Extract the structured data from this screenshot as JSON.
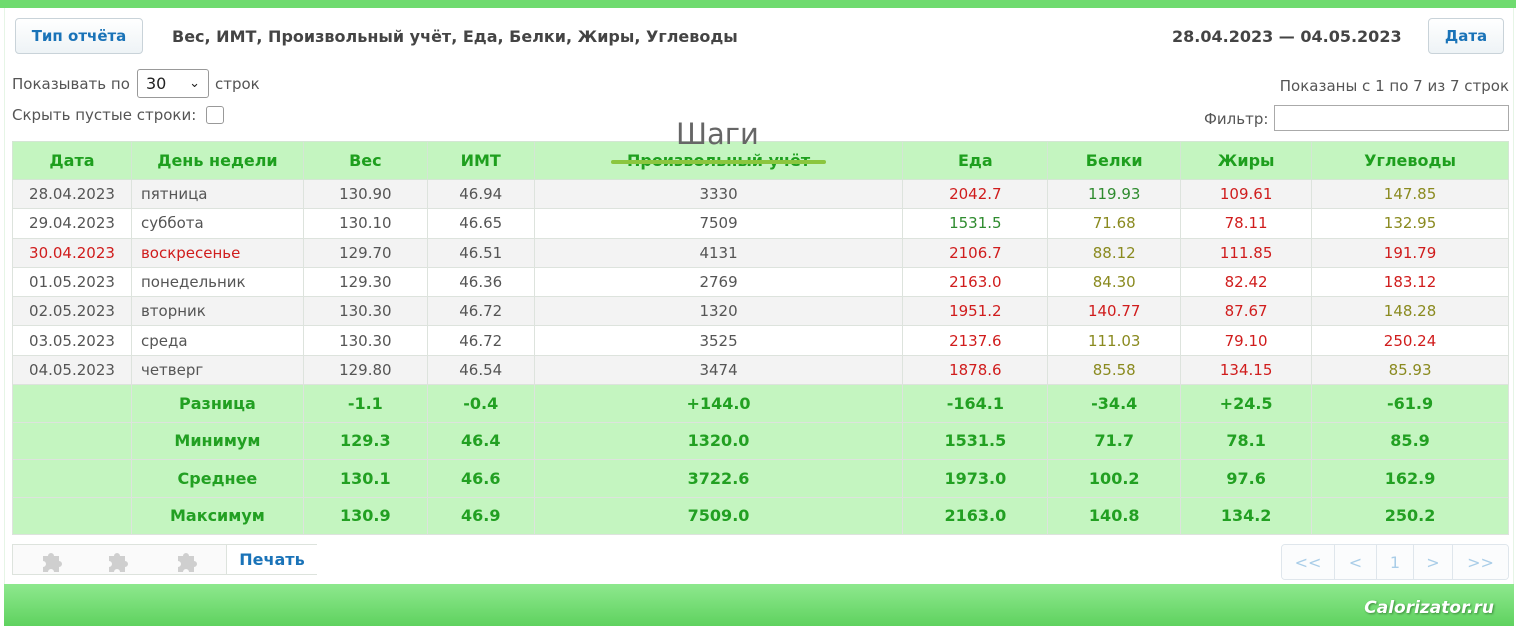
{
  "header": {
    "report_type_button": "Тип отчёта",
    "report_title": "Вес, ИМТ, Произвольный учёт, Еда, Белки, Жиры, Углеводы",
    "date_range": "28.04.2023 — 04.05.2023",
    "date_button": "Дата"
  },
  "controls": {
    "show_per_label": "Показывать по",
    "rows_per_page": "30",
    "rows_label": "строк",
    "hide_empty_label": "Скрыть пустые строки:",
    "showing_info": "Показаны с 1 по 7 из 7 строк",
    "filter_label": "Фильтр:",
    "filter_value": ""
  },
  "overlay_label": "Шаги",
  "table": {
    "columns": [
      "Дата",
      "День недели",
      "Вес",
      "ИМТ",
      "Произвольный учёт",
      "Еда",
      "Белки",
      "Жиры",
      "Углеводы"
    ],
    "rows": [
      {
        "date": "28.04.2023",
        "dow": "пятница",
        "weight": "130.90",
        "bmi": "46.94",
        "custom": "3330",
        "food": "2042.7",
        "protein": "119.93",
        "fat": "109.61",
        "carbs": "147.85",
        "weekend": false,
        "colors": {
          "food": "red",
          "protein": "green",
          "fat": "red",
          "carbs": "olive"
        }
      },
      {
        "date": "29.04.2023",
        "dow": "суббота",
        "weight": "130.10",
        "bmi": "46.65",
        "custom": "7509",
        "food": "1531.5",
        "protein": "71.68",
        "fat": "78.11",
        "carbs": "132.95",
        "weekend": false,
        "colors": {
          "food": "green",
          "protein": "olive",
          "fat": "red",
          "carbs": "olive"
        }
      },
      {
        "date": "30.04.2023",
        "dow": "воскресенье",
        "weight": "129.70",
        "bmi": "46.51",
        "custom": "4131",
        "food": "2106.7",
        "protein": "88.12",
        "fat": "111.85",
        "carbs": "191.79",
        "weekend": true,
        "colors": {
          "food": "red",
          "protein": "olive",
          "fat": "red",
          "carbs": "red"
        }
      },
      {
        "date": "01.05.2023",
        "dow": "понедельник",
        "weight": "129.30",
        "bmi": "46.36",
        "custom": "2769",
        "food": "2163.0",
        "protein": "84.30",
        "fat": "82.42",
        "carbs": "183.12",
        "weekend": false,
        "colors": {
          "food": "red",
          "protein": "olive",
          "fat": "red",
          "carbs": "red"
        }
      },
      {
        "date": "02.05.2023",
        "dow": "вторник",
        "weight": "130.30",
        "bmi": "46.72",
        "custom": "1320",
        "food": "1951.2",
        "protein": "140.77",
        "fat": "87.67",
        "carbs": "148.28",
        "weekend": false,
        "colors": {
          "food": "red",
          "protein": "red",
          "fat": "red",
          "carbs": "olive"
        }
      },
      {
        "date": "03.05.2023",
        "dow": "среда",
        "weight": "130.30",
        "bmi": "46.72",
        "custom": "3525",
        "food": "2137.6",
        "protein": "111.03",
        "fat": "79.10",
        "carbs": "250.24",
        "weekend": false,
        "colors": {
          "food": "red",
          "protein": "olive",
          "fat": "red",
          "carbs": "red"
        }
      },
      {
        "date": "04.05.2023",
        "dow": "четверг",
        "weight": "129.80",
        "bmi": "46.54",
        "custom": "3474",
        "food": "1878.6",
        "protein": "85.58",
        "fat": "134.15",
        "carbs": "85.93",
        "weekend": false,
        "colors": {
          "food": "red",
          "protein": "olive",
          "fat": "red",
          "carbs": "olive"
        }
      }
    ],
    "summary": [
      {
        "label": "Разница",
        "weight": "-1.1",
        "bmi": "-0.4",
        "custom": "+144.0",
        "food": "-164.1",
        "protein": "-34.4",
        "fat": "+24.5",
        "carbs": "-61.9"
      },
      {
        "label": "Минимум",
        "weight": "129.3",
        "bmi": "46.4",
        "custom": "1320.0",
        "food": "1531.5",
        "protein": "71.7",
        "fat": "78.1",
        "carbs": "85.9"
      },
      {
        "label": "Среднее",
        "weight": "130.1",
        "bmi": "46.6",
        "custom": "3722.6",
        "food": "1973.0",
        "protein": "100.2",
        "fat": "97.6",
        "carbs": "162.9"
      },
      {
        "label": "Максимум",
        "weight": "130.9",
        "bmi": "46.9",
        "custom": "7509.0",
        "food": "2163.0",
        "protein": "140.8",
        "fat": "134.2",
        "carbs": "250.2"
      }
    ]
  },
  "footer": {
    "print_button": "Печать",
    "toolbar_icons": [
      "puzzle-icon",
      "puzzle-icon",
      "puzzle-icon"
    ],
    "pager": {
      "first": "<<",
      "prev": "<",
      "current": "1",
      "next": ">",
      "last": ">>"
    },
    "brand": "Calorizator.ru"
  },
  "colors": {
    "accent_green": "#22a022",
    "header_bg": "#c4f5c0",
    "red": "#d01c1c",
    "green": "#2e8b2e",
    "olive": "#8a8a1f",
    "link_blue": "#1a73b8"
  }
}
